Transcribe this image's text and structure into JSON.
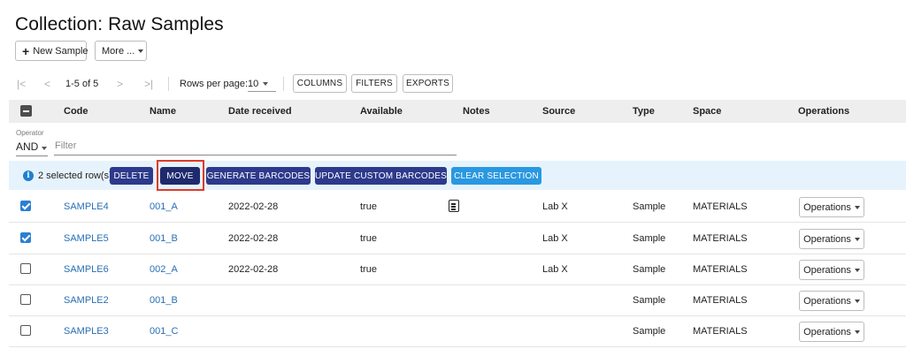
{
  "page": {
    "title": "Collection: Raw Samples"
  },
  "toolbar": {
    "new_sample_label": "New Sample",
    "more_label": "More ..."
  },
  "pagination": {
    "first": "|<",
    "prev": "<",
    "next": ">",
    "last": ">|",
    "range": "1-5 of 5",
    "rows_per_page_label": "Rows per page:",
    "rows_per_page_value": "10",
    "columns_label": "COLUMNS",
    "filters_label": "FILTERS",
    "exports_label": "EXPORTS"
  },
  "table": {
    "headers": {
      "code": "Code",
      "name": "Name",
      "date": "Date received",
      "available": "Available",
      "notes": "Notes",
      "source": "Source",
      "type": "Type",
      "space": "Space",
      "operations": "Operations"
    },
    "rows": [
      {
        "selected": true,
        "code": "SAMPLE4",
        "name": "001_A",
        "date": "2022-02-28",
        "available": "true",
        "has_note": true,
        "source": "Lab X",
        "type": "Sample",
        "space": "MATERIALS",
        "operations_label": "Operations"
      },
      {
        "selected": true,
        "code": "SAMPLE5",
        "name": "001_B",
        "date": "2022-02-28",
        "available": "true",
        "has_note": false,
        "source": "Lab X",
        "type": "Sample",
        "space": "MATERIALS",
        "operations_label": "Operations"
      },
      {
        "selected": false,
        "code": "SAMPLE6",
        "name": "002_A",
        "date": "2022-02-28",
        "available": "true",
        "has_note": false,
        "source": "Lab X",
        "type": "Sample",
        "space": "MATERIALS",
        "operations_label": "Operations"
      },
      {
        "selected": false,
        "code": "SAMPLE2",
        "name": "001_B",
        "date": "",
        "available": "",
        "has_note": false,
        "source": "",
        "type": "Sample",
        "space": "MATERIALS",
        "operations_label": "Operations"
      },
      {
        "selected": false,
        "code": "SAMPLE3",
        "name": "001_C",
        "date": "",
        "available": "",
        "has_note": false,
        "source": "",
        "type": "Sample",
        "space": "MATERIALS",
        "operations_label": "Operations"
      }
    ]
  },
  "filter": {
    "operator_label": "Operator",
    "operator_value": "AND",
    "placeholder": "Filter"
  },
  "selection": {
    "info_icon": "i",
    "text": "2 selected row(s):",
    "delete_label": "DELETE",
    "move_label": "MOVE",
    "generate_label": "GENERATE BARCODES",
    "update_label": "UPDATE CUSTOM BARCODES",
    "clear_label": "CLEAR SELECTION"
  },
  "colors": {
    "link": "#2a6fb5",
    "action_dark": "#2d3a8c",
    "action_blue": "#2a98e0",
    "highlight": "#e0392b",
    "selection_bg": "#e6f3fc"
  }
}
